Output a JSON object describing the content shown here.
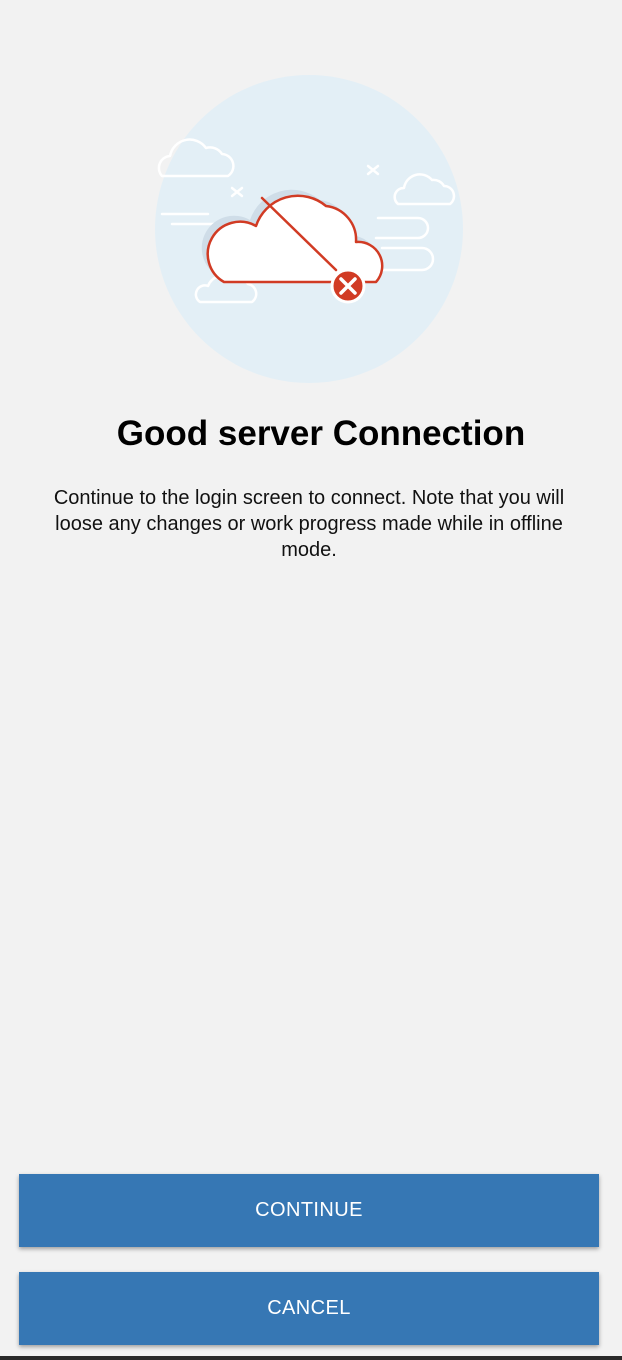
{
  "dialog": {
    "title": "Good server Connection",
    "message": "Continue to the login screen to connect. Note that you will loose any changes or work progress made while in offline mode.",
    "illustration_icon": "cloud-disconnected-icon"
  },
  "actions": {
    "continue_label": "CONTINUE",
    "cancel_label": "CANCEL"
  },
  "colors": {
    "background": "#f2f2f2",
    "button": "#3677b4",
    "button_text": "#ffffff",
    "illustration_circle": "#e3eff6",
    "alert_red": "#d13b24"
  }
}
